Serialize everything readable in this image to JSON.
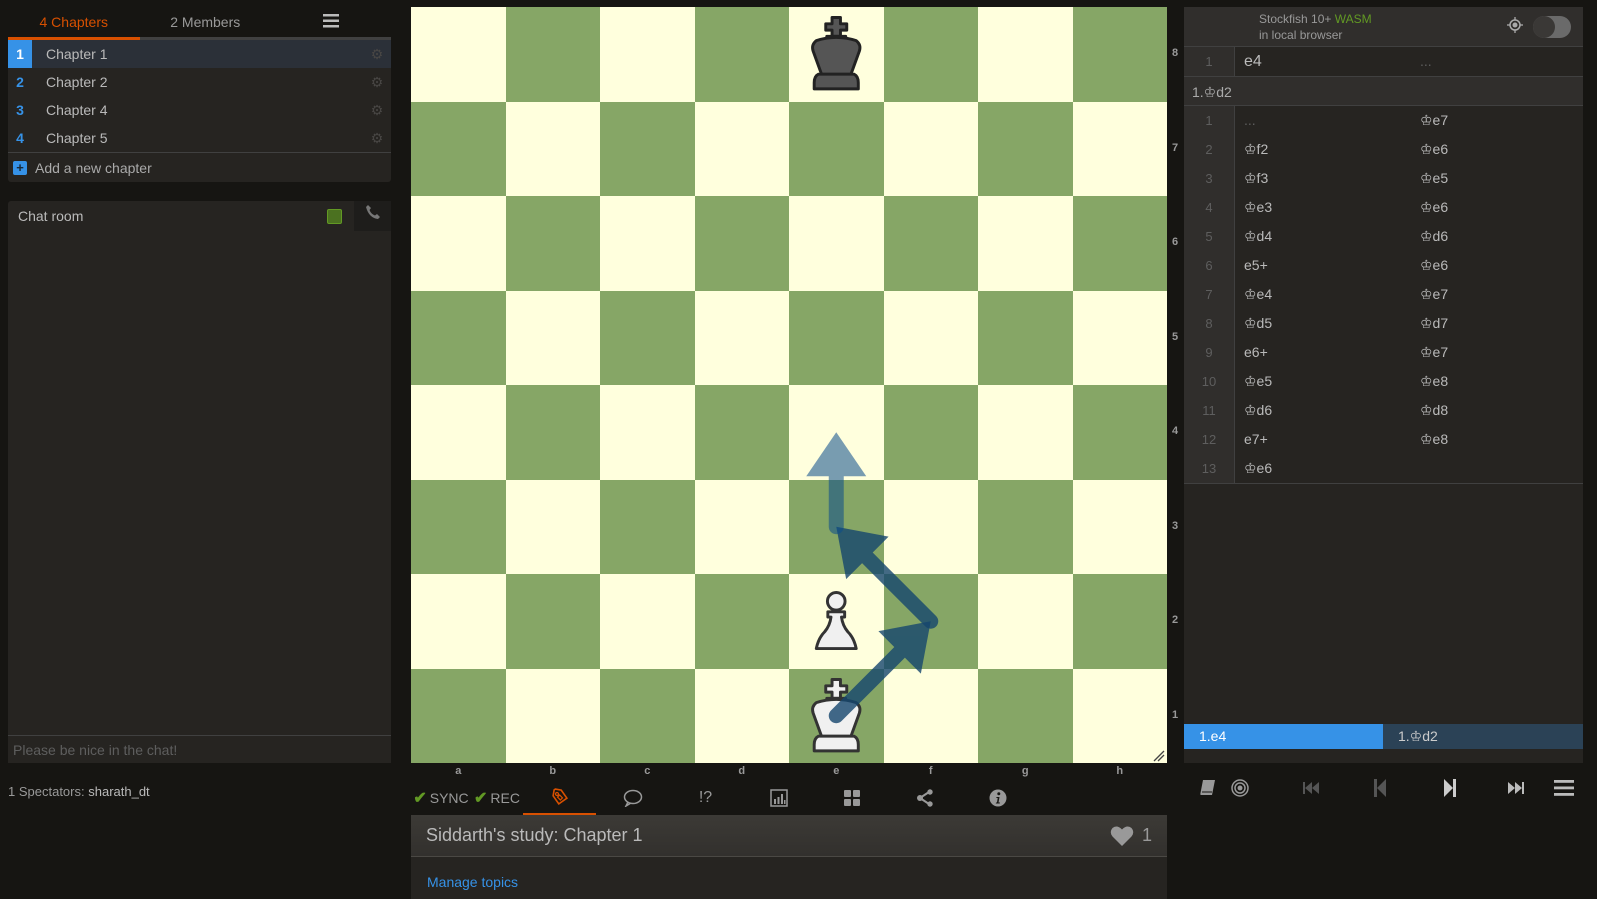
{
  "left_panel": {
    "tabs": [
      {
        "label": "4 Chapters",
        "active": true
      },
      {
        "label": "2 Members",
        "active": false
      }
    ],
    "menu_icon": "hamburger-menu-icon",
    "chapters": [
      {
        "num": "1",
        "title": "Chapter 1",
        "active": true
      },
      {
        "num": "2",
        "title": "Chapter 2",
        "active": false
      },
      {
        "num": "3",
        "title": "Chapter 4",
        "active": false
      },
      {
        "num": "4",
        "title": "Chapter 5",
        "active": false
      }
    ],
    "add_chapter_label": "Add a new chapter",
    "chat": {
      "title": "Chat room",
      "input_placeholder": "Please be nice in the chat!"
    },
    "spectators_label": "1 Spectators:",
    "spectators_names": "sharath_dt"
  },
  "board": {
    "colors": {
      "light": "#ffffdd",
      "dark": "#86a666",
      "arrow": "#15466e"
    },
    "orientation": "white",
    "files": [
      "a",
      "b",
      "c",
      "d",
      "e",
      "f",
      "g",
      "h"
    ],
    "ranks": [
      "8",
      "7",
      "6",
      "5",
      "4",
      "3",
      "2",
      "1"
    ],
    "pieces": [
      {
        "type": "king",
        "color": "black",
        "square": "e8"
      },
      {
        "type": "pawn",
        "color": "white",
        "square": "e2"
      },
      {
        "type": "king",
        "color": "white",
        "square": "e1"
      }
    ],
    "arrows": [
      {
        "from": "e1",
        "to": "f2"
      },
      {
        "from": "f2",
        "to": "e3"
      },
      {
        "from": "e3",
        "to": "e4"
      }
    ]
  },
  "toolbar": {
    "sync_label": "SYNC",
    "rec_label": "REC",
    "icons": [
      "tag-icon",
      "comment-icon",
      "glyph-icon",
      "chart-icon",
      "grid-icon",
      "share-icon",
      "info-icon"
    ],
    "glyph_text": "!?",
    "active_tool": "tag-icon"
  },
  "study": {
    "title": "Siddarth's study: Chapter 1",
    "likes": "1",
    "manage_topics_label": "Manage topics"
  },
  "engine": {
    "name": "Stockfish 10+",
    "variant": "WASM",
    "location": "in local browser",
    "enabled": false
  },
  "moves": {
    "mainline": {
      "index": "1",
      "white": "e4",
      "black": "..."
    },
    "variation_label": "1.♔d2",
    "rows": [
      {
        "index": "1",
        "white": "...",
        "black": "♔e7"
      },
      {
        "index": "2",
        "white": "♔f2",
        "black": "♔e6"
      },
      {
        "index": "3",
        "white": "♔f3",
        "black": "♔e5"
      },
      {
        "index": "4",
        "white": "♔e3",
        "black": "♔e6"
      },
      {
        "index": "5",
        "white": "♔d4",
        "black": "♔d6"
      },
      {
        "index": "6",
        "white": "e5+",
        "black": "♔e6"
      },
      {
        "index": "7",
        "white": "♔e4",
        "black": "♔e7"
      },
      {
        "index": "8",
        "white": "♔d5",
        "black": "♔d7"
      },
      {
        "index": "9",
        "white": "e6+",
        "black": "♔e7"
      },
      {
        "index": "10",
        "white": "♔e5",
        "black": "♔e8"
      },
      {
        "index": "11",
        "white": "♔d6",
        "black": "♔d8"
      },
      {
        "index": "12",
        "white": "e7+",
        "black": "♔e8"
      },
      {
        "index": "13",
        "white": "♔e6",
        "black": ""
      }
    ],
    "fork": [
      {
        "label": "1.e4",
        "active": true
      },
      {
        "label": "1.♔d2",
        "active": false
      }
    ]
  }
}
